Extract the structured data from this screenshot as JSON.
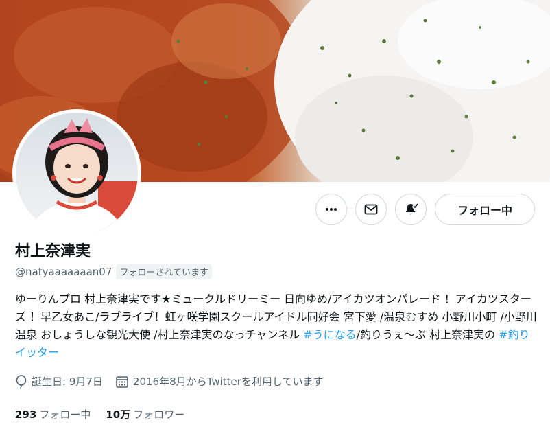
{
  "profile": {
    "name": "村上奈津実",
    "handle": "@natyaaaaaaan07",
    "follows_you": "フォローされています",
    "bio": {
      "part1": "ゆーりんプロ 村上奈津実です★ミュークルドリーミー 日向ゆめ/アイカツオンパレード ！アイカツスターズ ！早乙女あこ/ラブライブ！虹ヶ咲学園スクールアイドル同好会 宮下愛 /温泉むすめ 小野川小町 /小野川温泉 おしょうしな観光大使 /村上奈津実のなっチャンネル ",
      "hashtag1": "#うになる",
      "part2": "/釣りうぇ～ぶ 村上奈津実の ",
      "hashtag2": "#釣りイッター"
    },
    "birthday": "誕生日: 9月7日",
    "joined": "2016年8月からTwitterを利用しています",
    "following_count": "293",
    "following_label": "フォロー中",
    "followers_count": "10万",
    "followers_label": "フォロワー"
  },
  "actions": {
    "more_icon": "more-horizontal-icon",
    "message_icon": "envelope-icon",
    "notify_icon": "bell-check-icon",
    "follow_label": "フォロー中"
  },
  "icons": {
    "birthday": "balloon-icon",
    "joined": "calendar-icon"
  },
  "colors": {
    "link": "#1d9bf0",
    "muted": "#536471",
    "text": "#0f1419",
    "border": "#cfd9de"
  }
}
